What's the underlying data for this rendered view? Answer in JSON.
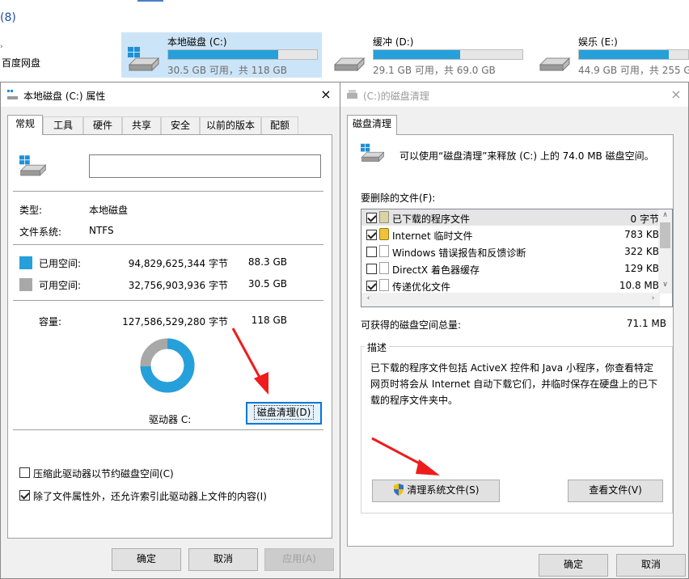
{
  "background": {
    "count_label": "(8)",
    "left_nav_label": "百度网盘",
    "drives": [
      {
        "name": "本地磁盘 (C:)",
        "info": "30.5 GB 可用，共 118 GB",
        "used_fraction": 0.74,
        "selected": true
      },
      {
        "name": "缓冲 (D:)",
        "info": "29.1 GB 可用，共 69.0 GB",
        "used_fraction": 0.58,
        "selected": false
      },
      {
        "name": "娱乐 (E:)",
        "info": "44.9 GB 可用，共 255 GB",
        "used_fraction": 0.82,
        "selected": false
      }
    ]
  },
  "properties_dialog": {
    "title": "本地磁盘 (C:) 属性",
    "close_icon": "×",
    "tabs": [
      "常规",
      "工具",
      "硬件",
      "共享",
      "安全",
      "以前的版本",
      "配额"
    ],
    "active_tab": "常规",
    "volume_label_value": "",
    "type_label": "类型:",
    "type_value": "本地磁盘",
    "fs_label": "文件系统:",
    "fs_value": "NTFS",
    "used_label": "已用空间:",
    "used_bytes": "94,829,625,344 字节",
    "used_gb": "88.3 GB",
    "free_label": "可用空间:",
    "free_bytes": "32,756,903,936 字节",
    "free_gb": "30.5 GB",
    "capacity_label": "容量:",
    "capacity_bytes": "127,586,529,280 字节",
    "capacity_gb": "118 GB",
    "used_fraction": 0.743,
    "drive_label": "驱动器 C:",
    "cleanup_button": "磁盘清理(D)",
    "compress_label": "压缩此驱动器以节约磁盘空间(C)",
    "compress_checked": false,
    "index_label": "除了文件属性外，还允许索引此驱动器上文件的内容(I)",
    "index_checked": true,
    "ok_button": "确定",
    "cancel_button": "取消",
    "apply_button": "应用(A)",
    "colors": {
      "used": "#26a0da",
      "free": "#a8a8a8"
    }
  },
  "cleanup_dialog": {
    "title": "(C:)的磁盘清理",
    "close_icon": "×",
    "tab": "磁盘清理",
    "summary": "可以使用“磁盘清理”来释放  (C:) 上的 74.0 MB 磁盘空间。",
    "files_to_delete_label": "要删除的文件(F):",
    "files": [
      {
        "name": "已下载的程序文件",
        "size": "0 字节",
        "checked": true,
        "icon": "folder-icon"
      },
      {
        "name": "Internet 临时文件",
        "size": "783 KB",
        "checked": true,
        "icon": "lock-icon"
      },
      {
        "name": "Windows 错误报告和反馈诊断",
        "size": "322 KB",
        "checked": false,
        "icon": "file-icon"
      },
      {
        "name": "DirectX 着色器缓存",
        "size": "129 KB",
        "checked": false,
        "icon": "file-icon"
      },
      {
        "name": "传递优化文件",
        "size": "10.8 MB",
        "checked": true,
        "icon": "file-icon"
      }
    ],
    "total_label": "可获得的磁盘空间总量:",
    "total_value": "71.1 MB",
    "description_heading": "描述",
    "description_text": "已下载的程序文件包括 ActiveX 控件和 Java 小程序，你查看特定网页时将会从 Internet 自动下载它们，并临时保存在硬盘上的已下载的程序文件夹中。",
    "cleanup_system_button": "清理系统文件(S)",
    "view_files_button": "查看文件(V)",
    "ok_button": "确定",
    "cancel_button": "取消"
  }
}
